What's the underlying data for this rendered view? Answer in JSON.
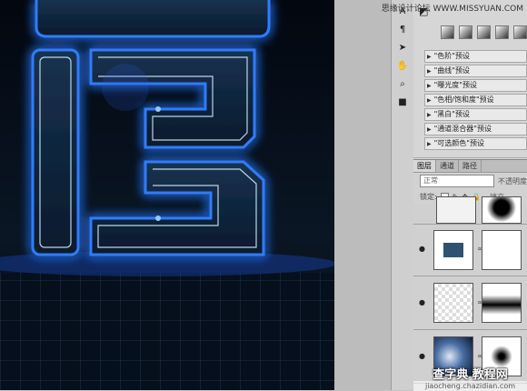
{
  "watermark_top": "思缘设计论坛  WWW.MISSYUAN.COM",
  "tool_icons": [
    "text-tool-icon",
    "type-tool-icon",
    "path-select-icon",
    "hand-tool-icon",
    "zoom-tool-icon",
    "foreground-color-icon"
  ],
  "adjustments_presets": [
    "\"色阶\"预设",
    "\"曲线\"预设",
    "\"曝光度\"预设",
    "\"色相/饱和度\"预设",
    "\"黑白\"预设",
    "\"通道混合器\"预设",
    "\"可选颜色\"预设"
  ],
  "layers_panel": {
    "tabs": [
      "图层",
      "通道",
      "路径"
    ],
    "blend_mode": "正常",
    "opacity_label": "不透明度",
    "lock_label": "锁定:",
    "fill_label": "填充"
  },
  "watermark_bottom": {
    "big": "查字典 教程网",
    "small": "jiaocheng.chazidian.com"
  },
  "colors": {
    "neon_blue": "#1e6cff",
    "neon_core": "#bfe4ff",
    "layer_swatch": "#2f5273"
  }
}
